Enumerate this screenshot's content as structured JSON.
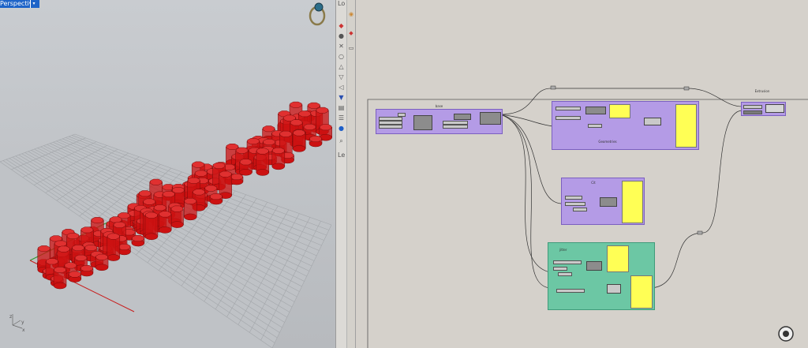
{
  "viewport": {
    "label": "Perspective",
    "dropdown_glyph": "▾",
    "icon": "ring-object-icon"
  },
  "toolbar": {
    "strip_label": "Lo",
    "bottom_label": "Le",
    "icons": [
      "camera-icon",
      "sphere-icon",
      "cursor-icon",
      "cube-icon",
      "scissor-icon",
      "circle-icon",
      "triangle-icon",
      "triangle-down-icon",
      "flag-icon",
      "filter-icon",
      "list-icon",
      "menu-icon",
      "help-icon",
      "search-icon"
    ],
    "strip2_icons": [
      "color-icon",
      "camera-icon",
      "display-icon"
    ]
  },
  "canvas": {
    "groups": [
      {
        "id": "base",
        "label": "base"
      },
      {
        "id": "geometries",
        "label": "Geometries"
      },
      {
        "id": "cit",
        "label": "Cit"
      },
      {
        "id": "jitter",
        "label": "jitter"
      },
      {
        "id": "extrusion",
        "label": "Extrusion"
      }
    ]
  },
  "colors": {
    "purple_group": "#b49be6",
    "green_group": "#6cc7a4",
    "panel": "#ffff55",
    "extrusion_red": "#cc1111",
    "viewport_bg": "#c0c3c7"
  }
}
